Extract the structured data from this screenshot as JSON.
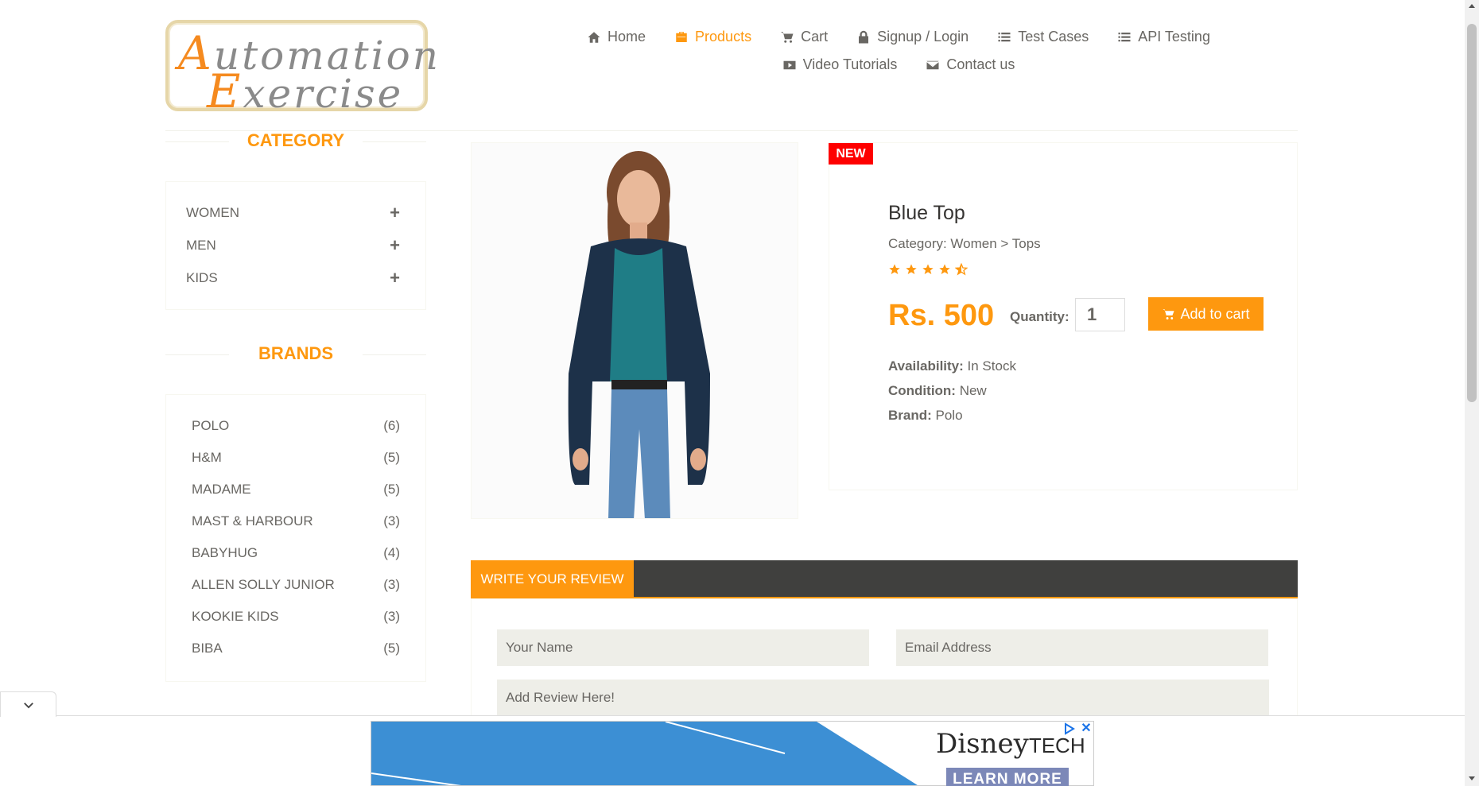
{
  "logo": {
    "line1_cap": "A",
    "line1_rest": "utomation",
    "line2_cap": "E",
    "line2_rest": "xercise"
  },
  "nav": {
    "row1": [
      {
        "name": "nav-home",
        "icon": "home-icon",
        "label": "Home",
        "active": false
      },
      {
        "name": "nav-products",
        "icon": "briefcase-icon",
        "label": "Products",
        "active": true
      },
      {
        "name": "nav-cart",
        "icon": "cart-icon",
        "label": "Cart",
        "active": false
      },
      {
        "name": "nav-signup-login",
        "icon": "lock-icon",
        "label": "Signup / Login",
        "active": false
      },
      {
        "name": "nav-test-cases",
        "icon": "list-icon",
        "label": "Test Cases",
        "active": false
      },
      {
        "name": "nav-api-testing",
        "icon": "list-icon",
        "label": "API Testing",
        "active": false
      }
    ],
    "row2": [
      {
        "name": "nav-video-tutorials",
        "icon": "youtube-icon",
        "label": "Video Tutorials",
        "active": false
      },
      {
        "name": "nav-contact-us",
        "icon": "envelope-icon",
        "label": "Contact us",
        "active": false
      }
    ]
  },
  "sidebar": {
    "category_title": "CATEGORY",
    "categories": [
      {
        "label": "WOMEN",
        "toggle": "+"
      },
      {
        "label": "MEN",
        "toggle": "+"
      },
      {
        "label": "KIDS",
        "toggle": "+"
      }
    ],
    "brands_title": "BRANDS",
    "brands": [
      {
        "label": "POLO",
        "count": "(6)"
      },
      {
        "label": "H&M",
        "count": "(5)"
      },
      {
        "label": "MADAME",
        "count": "(5)"
      },
      {
        "label": "MAST & HARBOUR",
        "count": "(3)"
      },
      {
        "label": "BABYHUG",
        "count": "(4)"
      },
      {
        "label": "ALLEN SOLLY JUNIOR",
        "count": "(3)"
      },
      {
        "label": "KOOKIE KIDS",
        "count": "(3)"
      },
      {
        "label": "BIBA",
        "count": "(5)"
      }
    ]
  },
  "product": {
    "badge": "NEW",
    "name": "Blue Top",
    "category": "Category: Women > Tops",
    "rating": 4.5,
    "price": "Rs. 500",
    "quantity_label": "Quantity:",
    "quantity_value": "1",
    "add_to_cart": "Add to cart",
    "availability_label": "Availability:",
    "availability_value": "In Stock",
    "condition_label": "Condition:",
    "condition_value": "New",
    "brand_label": "Brand:",
    "brand_value": "Polo"
  },
  "review": {
    "tab_label": "WRITE YOUR REVIEW",
    "name_placeholder": "Your Name",
    "email_placeholder": "Email Address",
    "review_placeholder": "Add Review Here!"
  },
  "ad": {
    "brand_main": "Disney",
    "brand_suffix": "TECH",
    "cta": "LEARN MORE",
    "close": "✕"
  },
  "colors": {
    "accent": "#fe980f",
    "text": "#696763",
    "dark_bar": "#40403e",
    "badge": "#fe0000"
  }
}
